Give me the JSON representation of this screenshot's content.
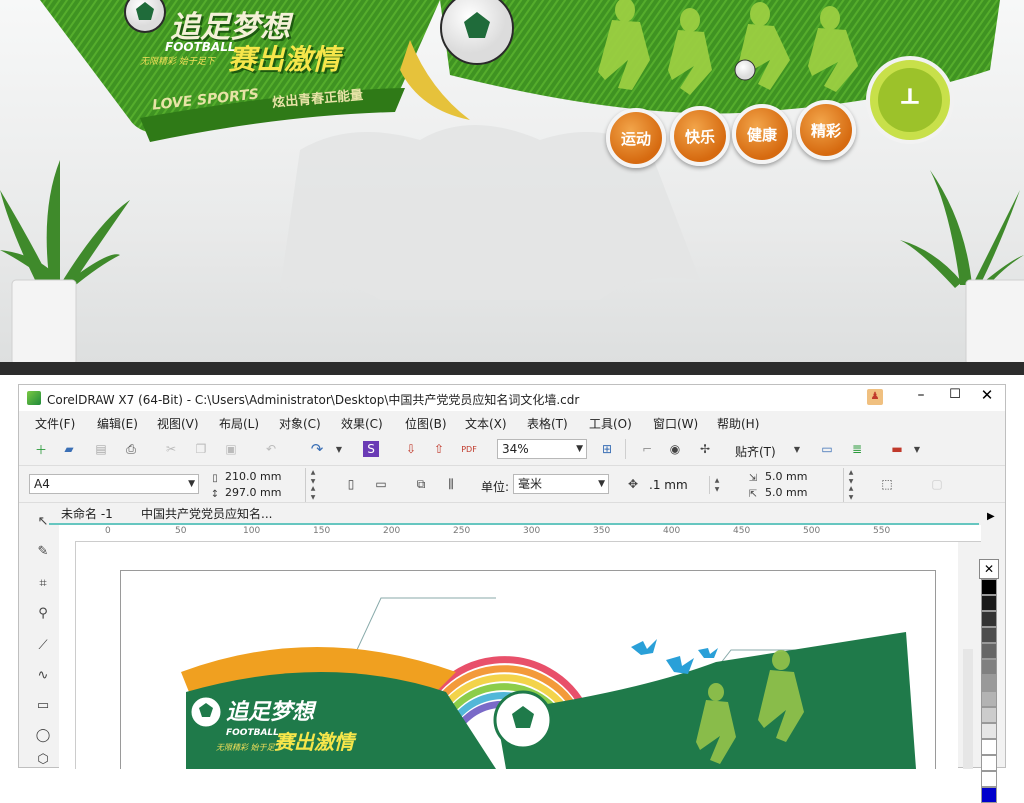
{
  "render": {
    "title_main": "追足梦想",
    "title_sub1": "FOOTBALL",
    "title_sub2": "赛出激情",
    "slogan_small": "无限精彩 始于足下",
    "love_sports": "LOVE SPORTS",
    "love_sports_cn": "炫出青春正能量",
    "pills": [
      "运动",
      "快乐",
      "健康",
      "精彩"
    ]
  },
  "titlebar": {
    "title": "CorelDRAW X7 (64-Bit) - C:\\Users\\Administrator\\Desktop\\中国共产党党员应知名词文化墙.cdr"
  },
  "menu": [
    "文件(F)",
    "编辑(E)",
    "视图(V)",
    "布局(L)",
    "对象(C)",
    "效果(C)",
    "位图(B)",
    "文本(X)",
    "表格(T)",
    "工具(O)",
    "窗口(W)",
    "帮助(H)"
  ],
  "toolbar": {
    "zoom": "34%",
    "snap": "贴齐(T)"
  },
  "propbar": {
    "page_size": "A4",
    "width": "210.0 mm",
    "height": "297.0 mm",
    "unit_label": "单位:",
    "unit_value": "毫米",
    "nudge": ".1 mm",
    "dup_x": "5.0 mm",
    "dup_y": "5.0 mm"
  },
  "doc_tabs": [
    "未命名 -1",
    "中国共产党党员应知名..."
  ],
  "ruler": {
    "ticks": [
      "0",
      "50",
      "100",
      "150",
      "200",
      "250",
      "300",
      "350",
      "400",
      "450",
      "500",
      "550"
    ]
  },
  "canvas": {
    "title_main": "追足梦想",
    "title_sub1": "FOOTBALL",
    "title_sub2": "赛出激情",
    "slogan_small": "无限精彩 始于足下"
  },
  "palette": [
    "#000000",
    "#1a1a1a",
    "#333333",
    "#4d4d4d",
    "#666666",
    "#808080",
    "#999999",
    "#b3b3b3",
    "#cccccc",
    "#e6e6e6",
    "#ffffff",
    "#ffffff",
    "#ffffff",
    "#0000cc"
  ],
  "colors": {
    "brand_green": "#3a8a24",
    "accent_orange": "#e08a1a",
    "canvas_green": "#1f7a4a"
  }
}
